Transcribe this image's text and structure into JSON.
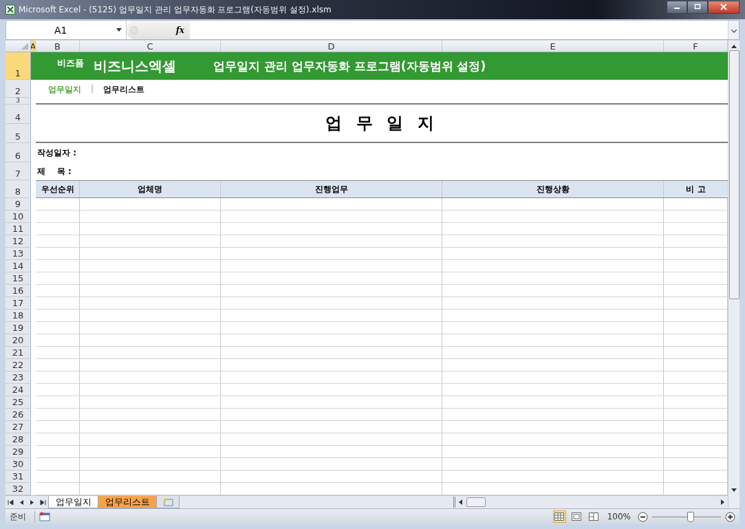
{
  "window": {
    "title": "Microsoft Excel - (5125) 업무일지 관리 업무자동화 프로그램(자동범위 설정).xlsm"
  },
  "formula_bar": {
    "name_box": "A1",
    "function_label": "fx"
  },
  "columns": [
    {
      "label": "A",
      "selected": true
    },
    {
      "label": "B",
      "selected": false
    },
    {
      "label": "C",
      "selected": false
    },
    {
      "label": "D",
      "selected": false
    },
    {
      "label": "E",
      "selected": false
    },
    {
      "label": "F",
      "selected": false
    }
  ],
  "rows": [
    {
      "label": "1",
      "selected": true
    },
    {
      "label": "2",
      "selected": false
    },
    {
      "label": "3",
      "selected": false
    },
    {
      "label": "4",
      "selected": false
    },
    {
      "label": "5",
      "selected": false
    },
    {
      "label": "6",
      "selected": false
    },
    {
      "label": "7",
      "selected": false
    },
    {
      "label": "8",
      "selected": false
    },
    {
      "label": "9",
      "selected": false
    },
    {
      "label": "10",
      "selected": false
    },
    {
      "label": "11",
      "selected": false
    },
    {
      "label": "12",
      "selected": false
    },
    {
      "label": "13",
      "selected": false
    },
    {
      "label": "14",
      "selected": false
    },
    {
      "label": "15",
      "selected": false
    },
    {
      "label": "16",
      "selected": false
    },
    {
      "label": "17",
      "selected": false
    },
    {
      "label": "18",
      "selected": false
    },
    {
      "label": "19",
      "selected": false
    },
    {
      "label": "20",
      "selected": false
    },
    {
      "label": "21",
      "selected": false
    },
    {
      "label": "22",
      "selected": false
    },
    {
      "label": "23",
      "selected": false
    },
    {
      "label": "24",
      "selected": false
    },
    {
      "label": "25",
      "selected": false
    },
    {
      "label": "26",
      "selected": false
    },
    {
      "label": "27",
      "selected": false
    },
    {
      "label": "28",
      "selected": false
    },
    {
      "label": "29",
      "selected": false
    },
    {
      "label": "30",
      "selected": false
    },
    {
      "label": "31",
      "selected": false
    },
    {
      "label": "32",
      "selected": false
    }
  ],
  "banner": {
    "brand_small": "비즈폼",
    "brand": "비즈니스엑셀",
    "title": "업무일지 관리 업무자동화 프로그램(자동범위 설정)"
  },
  "nav": {
    "items": [
      {
        "label": "업무일지",
        "selected": true
      },
      {
        "label": "업무리스트",
        "selected": false
      }
    ],
    "separator": "|"
  },
  "doc_title": "업 무 일 지",
  "fields": [
    {
      "label": "작성일자 :"
    },
    {
      "label": "제    목 :"
    }
  ],
  "table": {
    "columns": [
      "우선순위",
      "업체명",
      "진행업무",
      "진행상황",
      "비 고"
    ]
  },
  "sheet_tabs": [
    {
      "label": "업무일지",
      "selected": true
    },
    {
      "label": "업무리스트",
      "selected": false,
      "color": "#f8a34a"
    }
  ],
  "status_bar": {
    "status": "준비",
    "view_buttons": [
      {
        "selected": true
      },
      {
        "selected": false
      },
      {
        "selected": false
      }
    ],
    "zoom": "100%",
    "zoom_level": {
      "level": 0.55
    }
  }
}
